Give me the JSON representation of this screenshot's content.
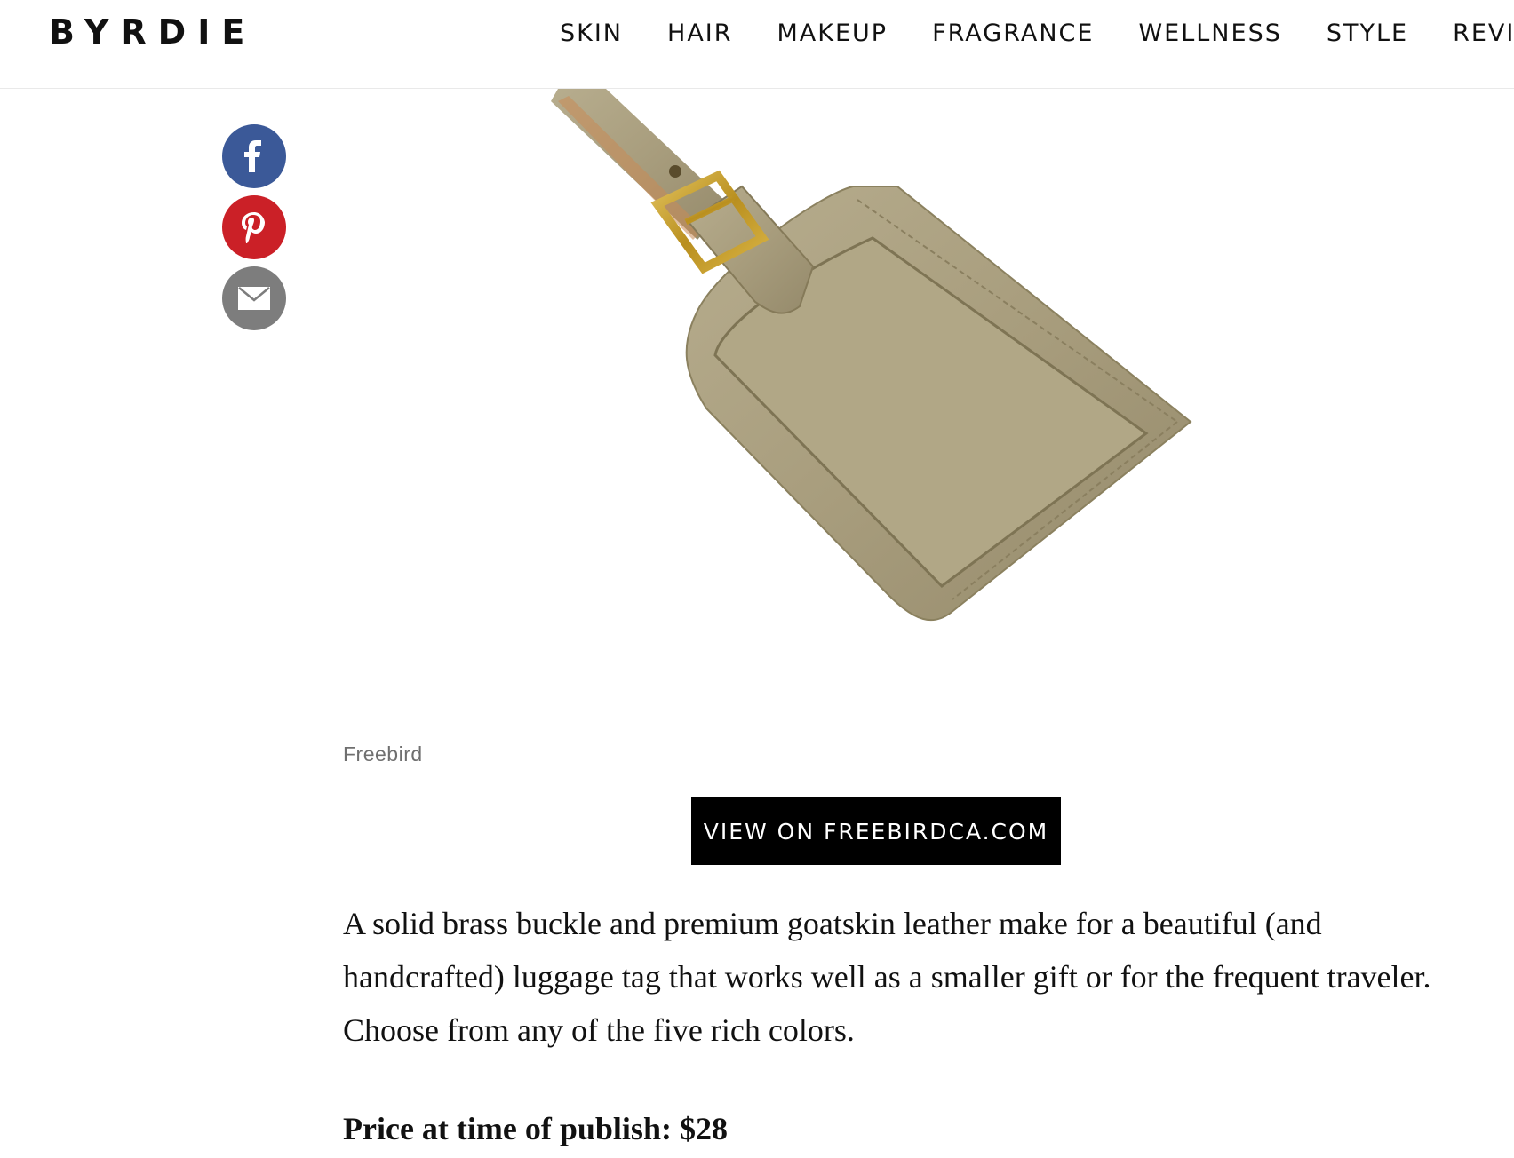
{
  "header": {
    "logo": "BYRDIE",
    "nav": [
      "SKIN",
      "HAIR",
      "MAKEUP",
      "FRAGRANCE",
      "WELLNESS",
      "STYLE",
      "REVIEWS"
    ]
  },
  "share": {
    "facebook_icon": "facebook-icon",
    "pinterest_icon": "pinterest-icon",
    "email_icon": "email-icon",
    "colors": {
      "facebook": "#3b5998",
      "pinterest": "#cb2027",
      "email": "#7d7d7d"
    }
  },
  "product": {
    "image_caption": "Freebird",
    "cta_label": "VIEW ON FREEBIRDCA.COM",
    "description": "A solid brass buckle and premium goatskin leather make for a beautiful (and handcrafted) luggage tag that works well as a smaller gift or for the frequent traveler. Choose from any of the five rich colors.",
    "price": "Price at time of publish: $28"
  }
}
